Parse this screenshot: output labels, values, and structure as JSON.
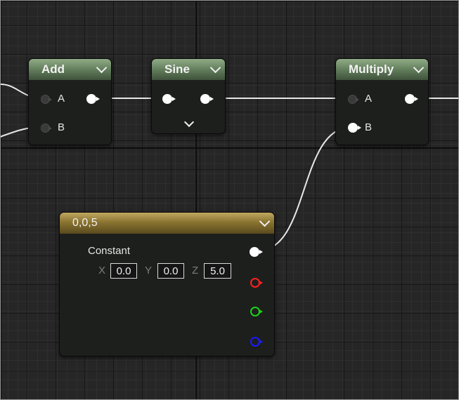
{
  "nodes": {
    "add": {
      "title": "Add",
      "input_a": "A",
      "input_b": "B"
    },
    "sine": {
      "title": "Sine"
    },
    "multiply": {
      "title": "Multiply",
      "input_a": "A",
      "input_b": "B"
    },
    "constant": {
      "title": "0,0,5",
      "label": "Constant",
      "x_label": "X",
      "x_value": "0.0",
      "y_label": "Y",
      "y_value": "0.0",
      "z_label": "Z",
      "z_value": "5.0"
    }
  },
  "colors": {
    "node_header_green": "#6f8a67",
    "node_header_gold": "#9a843c",
    "wire": "#e8e8e8",
    "pin_red": "#ff2020",
    "pin_green": "#19d119",
    "pin_blue": "#1a1aff"
  }
}
